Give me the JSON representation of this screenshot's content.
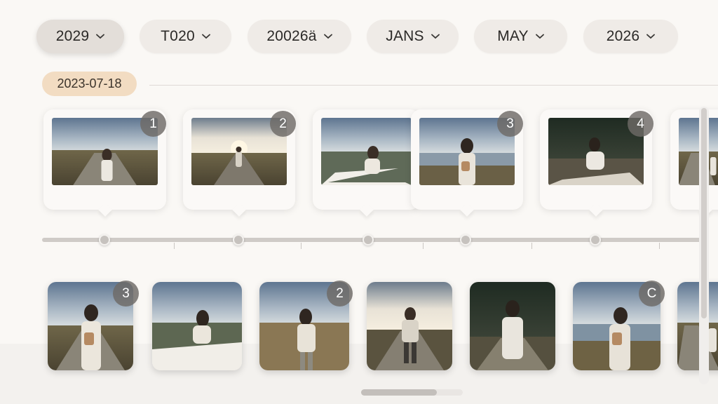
{
  "filters": [
    {
      "label": "2029",
      "active": true
    },
    {
      "label": "T020",
      "active": false
    },
    {
      "label": "20026ä",
      "active": false
    },
    {
      "label": "JANS",
      "active": false
    },
    {
      "label": "MAY",
      "active": false
    },
    {
      "label": "2026",
      "active": false
    }
  ],
  "date_badge": "2023-07-18",
  "top_cards": [
    {
      "badge": "1",
      "scene": "standing-road"
    },
    {
      "badge": "2",
      "scene": "walking-away-sunset"
    },
    {
      "badge": "",
      "scene": "sitting-blanket"
    },
    {
      "badge": "3",
      "scene": "holding-cup-lake"
    },
    {
      "badge": "4",
      "scene": "sitting-forest-path"
    },
    {
      "badge": "",
      "scene": "partial-road"
    }
  ],
  "bottom_tiles": [
    {
      "badge": "3",
      "scene": "holding-cup-road"
    },
    {
      "badge": "",
      "scene": "sitting-blanket-back"
    },
    {
      "badge": "2",
      "scene": "standing-grass-back"
    },
    {
      "badge": "",
      "scene": "walking-road-sunset"
    },
    {
      "badge": "",
      "scene": "forest-path-smiling"
    },
    {
      "badge": "C",
      "scene": "holding-cup-lake"
    },
    {
      "badge": "",
      "scene": "partial-road"
    }
  ],
  "colors": {
    "background": "#faf8f5",
    "chip": "#efebe7",
    "date_badge": "#f2dcc2",
    "photo_badge": "#6e6a66"
  }
}
